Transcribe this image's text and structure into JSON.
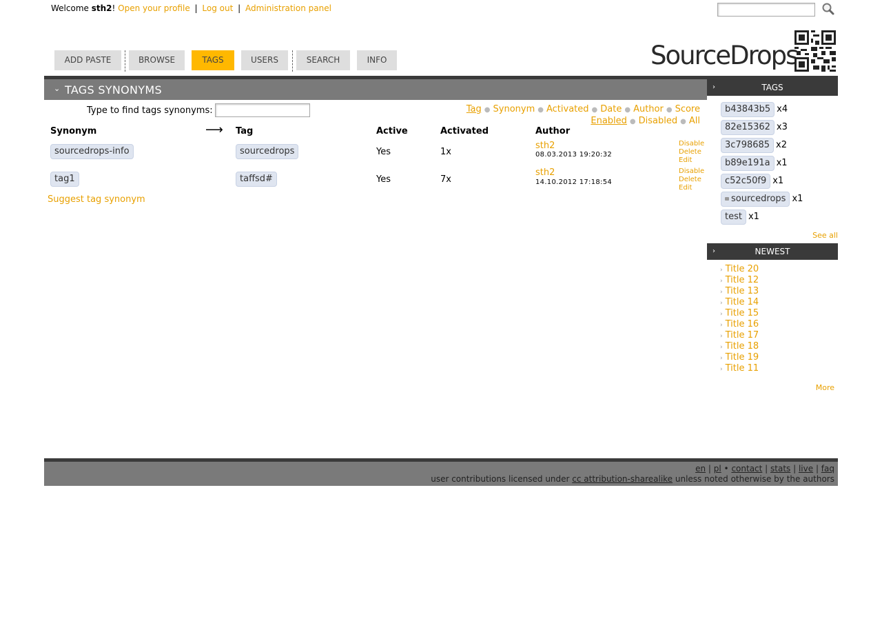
{
  "topbar": {
    "welcome_prefix": "Welcome ",
    "username": "sth2",
    "welcome_suffix": "!",
    "profile_link": "Open your profile",
    "logout_link": "Log out",
    "admin_link": "Administration panel",
    "separator": "|"
  },
  "search": {
    "value": ""
  },
  "nav": {
    "tabs": [
      {
        "label": "ADD PASTE"
      },
      {
        "label": "BROWSE"
      },
      {
        "label": "TAGS"
      },
      {
        "label": "USERS"
      },
      {
        "label": "SEARCH"
      },
      {
        "label": "INFO"
      }
    ],
    "active": "TAGS"
  },
  "logo": {
    "text": "SourceDrops"
  },
  "main": {
    "title": "TAGS SYNONYMS",
    "find_label": "Type to find tags synonyms:",
    "find_value": "",
    "sort": {
      "fields": [
        "Tag",
        "Synonym",
        "Activated",
        "Date",
        "Author",
        "Score"
      ],
      "selected_field": "Tag",
      "filters": [
        "Enabled",
        "Disabled",
        "All"
      ],
      "selected_filter": "Enabled"
    },
    "columns": {
      "synonym": "Synonym",
      "arrow": "⟶",
      "tag": "Tag",
      "active": "Active",
      "activated": "Activated",
      "author": "Author"
    },
    "rows": [
      {
        "synonym": "sourcedrops-info",
        "tag": "sourcedrops",
        "active": "Yes",
        "activated": "1x",
        "author": "sth2",
        "date": "08.03.2013 19:20:32",
        "actions": [
          "Disable",
          "Delete",
          "Edit"
        ]
      },
      {
        "synonym": "tag1",
        "tag": "taffsd#",
        "active": "Yes",
        "activated": "7x",
        "author": "sth2",
        "date": "14.10.2012 17:18:54",
        "actions": [
          "Disable",
          "Delete",
          "Edit"
        ]
      }
    ],
    "suggest_link": "Suggest tag synonym"
  },
  "sidebar": {
    "tags_title": "TAGS",
    "tags": [
      {
        "name": "b43843b5",
        "count": "x4",
        "locked": false
      },
      {
        "name": "82e15362",
        "count": "x3",
        "locked": false
      },
      {
        "name": "3c798685",
        "count": "x2",
        "locked": false
      },
      {
        "name": "b89e191a",
        "count": "x1",
        "locked": false
      },
      {
        "name": "c52c50f9",
        "count": "x1",
        "locked": false
      },
      {
        "name": "sourcedrops",
        "count": "x1",
        "locked": true
      },
      {
        "name": "test",
        "count": "x1",
        "locked": false
      }
    ],
    "see_all": "See all",
    "newest_title": "NEWEST",
    "newest": [
      "Title 20",
      "Title 12",
      "Title 13",
      "Title 14",
      "Title 15",
      "Title 16",
      "Title 17",
      "Title 18",
      "Title 19",
      "Title 11"
    ],
    "more": "More"
  },
  "footer": {
    "lang_en": "en",
    "lang_pl": "pl",
    "contact": "contact",
    "stats": "stats",
    "live": "live",
    "faq": "faq",
    "license_prefix": "user contributions licensed under ",
    "license_link": "cc attribution-sharealike",
    "license_suffix": " unless noted otherwise by the authors"
  },
  "colors": {
    "accent": "#e8a000",
    "active_tab": "#ffb800",
    "header_gray": "#7a7a7a",
    "dark_bar": "#3a3a3a",
    "tag_bg": "#dfe5f0"
  }
}
